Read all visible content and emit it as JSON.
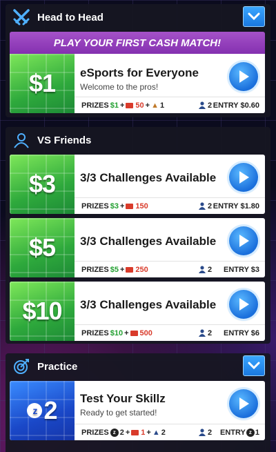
{
  "sections": {
    "head_to_head": {
      "title": "Head to Head",
      "banner": "PLAY YOUR FIRST CASH MATCH!",
      "card": {
        "price": "$1",
        "title": "eSports for Everyone",
        "subtitle": "Welcome to the pros!",
        "prizes_label": "PRIZES",
        "prize_cash": "$1",
        "prize_tickets": "50",
        "prize_extra": "1",
        "players": "2",
        "entry": "ENTRY $0.60"
      }
    },
    "vs_friends": {
      "title": "VS Friends",
      "cards": [
        {
          "price": "$3",
          "title": "3/3 Challenges Available",
          "prizes_label": "PRIZES",
          "prize_cash": "$3",
          "prize_tickets": "150",
          "players": "2",
          "entry": "ENTRY $1.80"
        },
        {
          "price": "$5",
          "title": "3/3 Challenges Available",
          "prizes_label": "PRIZES",
          "prize_cash": "$5",
          "prize_tickets": "250",
          "players": "2",
          "entry": "ENTRY $3"
        },
        {
          "price": "$10",
          "title": "3/3 Challenges Available",
          "prizes_label": "PRIZES",
          "prize_cash": "$10",
          "prize_tickets": "500",
          "players": "2",
          "entry": "ENTRY $6"
        }
      ]
    },
    "practice": {
      "title": "Practice",
      "card": {
        "price": "2",
        "title": "Test Your Skillz",
        "subtitle": "Ready to get started!",
        "prizes_label": "PRIZES",
        "prize_z": "2",
        "prize_tickets": "1",
        "prize_extra": "2",
        "players": "2",
        "entry_label": "ENTRY",
        "entry_value": "1"
      }
    }
  },
  "icons": {
    "head_to_head": "crossed-swords-icon",
    "vs_friends": "person-outline-icon",
    "practice": "target-icon",
    "collapse": "chevron-down-icon",
    "play": "play-icon",
    "players": "person-icon",
    "ticket": "ticket-icon",
    "z_coin": "z-coin-icon"
  },
  "colors": {
    "accent_blue": "#1a6fdc",
    "banner_purple": "#9a45c0",
    "prize_green": "#24a032",
    "ticket_red": "#d93b2b"
  }
}
